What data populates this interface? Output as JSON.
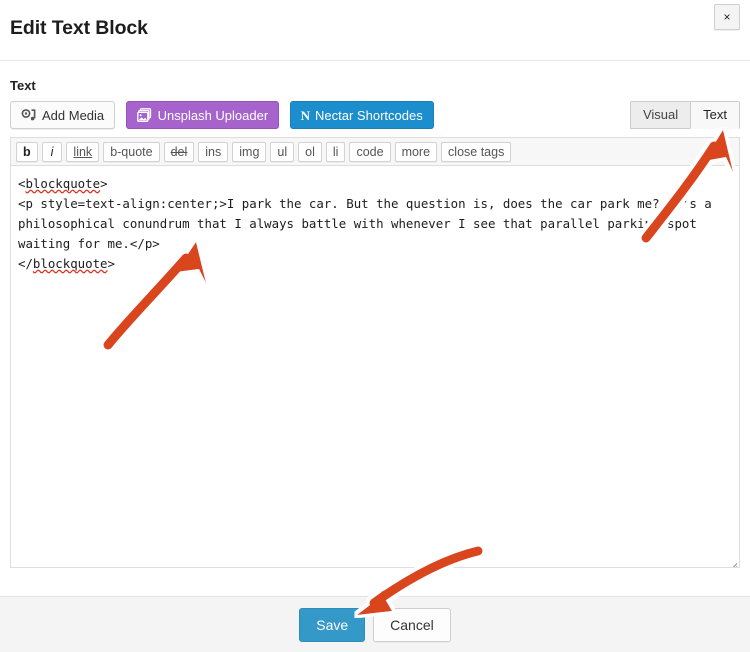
{
  "modal": {
    "title": "Edit Text Block",
    "close_label": "×"
  },
  "field": {
    "label": "Text"
  },
  "media_buttons": [
    {
      "label": "Add Media",
      "icon": "add-media-icon",
      "style": "default"
    },
    {
      "label": "Unsplash Uploader",
      "icon": "unsplash-icon",
      "style": "purple",
      "color": "#a663cc"
    },
    {
      "label": "Nectar Shortcodes",
      "icon": "nectar-n-icon",
      "style": "blue",
      "color": "#1d8ecd",
      "icon_text": "N"
    }
  ],
  "editor_tabs": [
    {
      "label": "Visual",
      "active": false
    },
    {
      "label": "Text",
      "active": true
    }
  ],
  "quicktags": [
    {
      "label": "b",
      "style": "bold"
    },
    {
      "label": "i",
      "style": "italic"
    },
    {
      "label": "link",
      "style": "underline"
    },
    {
      "label": "b-quote",
      "style": "plain"
    },
    {
      "label": "del",
      "style": "strikethrough"
    },
    {
      "label": "ins",
      "style": "plain"
    },
    {
      "label": "img",
      "style": "plain"
    },
    {
      "label": "ul",
      "style": "plain"
    },
    {
      "label": "ol",
      "style": "plain"
    },
    {
      "label": "li",
      "style": "plain"
    },
    {
      "label": "code",
      "style": "plain"
    },
    {
      "label": "more",
      "style": "plain"
    },
    {
      "label": "close tags",
      "style": "plain"
    }
  ],
  "editor": {
    "content_lines": [
      "<blockquote>",
      "<p style=text-align:center;>I park the car. But the question is, does the car park me? It's a philosophical conundrum that I always battle with whenever I see that parallel parking spot waiting for me.</p>",
      "</blockquote>"
    ],
    "content": "<blockquote>\n<p style=text-align:center;>I park the car. But the question is, does the car park me? It's a philosophical conundrum that I always battle with whenever I see that parallel parking spot waiting for me.</p>\n</blockquote>",
    "open_tag": "<blockquote>",
    "close_tag": "</blockquote>",
    "paragraph": "<p style=text-align:center;>I park the car. But the question is, does the car park me? It's a philosophical conundrum that I always battle with whenever I see that parallel parking spot waiting for me.</p>",
    "spellcheck_word": "blockquote"
  },
  "footer": {
    "save_label": "Save",
    "cancel_label": "Cancel",
    "save_color": "#3498c8"
  },
  "annotations": {
    "arrow_color": "#d9441a",
    "arrows": [
      {
        "name": "arrow-to-textarea",
        "points_to": "editor-textarea"
      },
      {
        "name": "arrow-to-text-tab",
        "points_to": "tab-text"
      },
      {
        "name": "arrow-to-save",
        "points_to": "save-button"
      }
    ]
  }
}
